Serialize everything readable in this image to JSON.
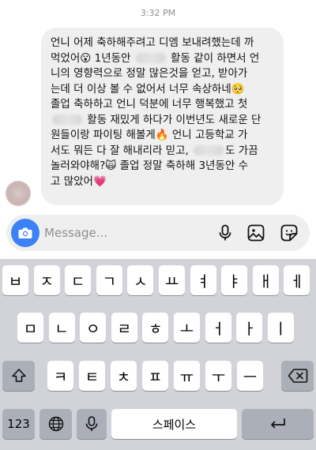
{
  "chat": {
    "timestamp": "3:32 PM",
    "message_lines": [
      {
        "parts": [
          "언니 어제 축하해주려고 디엠 보내려했는데 까"
        ]
      },
      {
        "parts": [
          "먹었어😮 1년동안 ",
          "",
          " 활동 같이 하면서 언"
        ]
      },
      {
        "parts": [
          "니의 영향력으로 정말 많은것을 얻고, 받아가"
        ]
      },
      {
        "parts": [
          "는데 더 이상 볼 수 없어서 너무 속상하네🥺"
        ]
      },
      {
        "parts": [
          "졸업 축하하고 언니 덕분에 너무 행복했고 첫"
        ]
      },
      {
        "parts": [
          "",
          " 활동 재밌게 하다가 이번년도 새로운 단"
        ]
      },
      {
        "parts": [
          "원들이랑 파이팅 해볼게🔥 언니 고등학교 가"
        ]
      },
      {
        "parts": [
          "서도 뭐든 다 잘 해내리라 믿고, ",
          "",
          "도 가끔"
        ]
      },
      {
        "parts": [
          "놀러와야해?🙀 졸업 정말 축하해 3년동안 수"
        ]
      },
      {
        "parts": [
          "고 많았어💗"
        ]
      }
    ]
  },
  "composer": {
    "placeholder": "Message...",
    "camera_icon": "camera-icon",
    "mic_icon": "microphone-icon",
    "gallery_icon": "image-icon",
    "sticker_icon": "sticker-icon",
    "accent_color": "#3b82f6"
  },
  "keyboard": {
    "row1": [
      "ㅂ",
      "ㅈ",
      "ㄷ",
      "ㄱ",
      "ㅅ",
      "ㅛ",
      "ㅕ",
      "ㅑ",
      "ㅐ",
      "ㅔ"
    ],
    "row2": [
      "ㅁ",
      "ㄴ",
      "ㅇ",
      "ㄹ",
      "ㅎ",
      "ㅗ",
      "ㅓ",
      "ㅏ",
      "ㅣ"
    ],
    "row3": [
      "ㅋ",
      "ㅌ",
      "ㅊ",
      "ㅍ",
      "ㅠ",
      "ㅜ",
      "ㅡ"
    ],
    "shift_icon": "shift-icon",
    "delete_icon": "delete-icon",
    "numbers_label": "123",
    "globe_icon": "globe-icon",
    "dictation_icon": "microphone-icon",
    "space_label": "스페이스",
    "return_icon": "return-icon"
  }
}
